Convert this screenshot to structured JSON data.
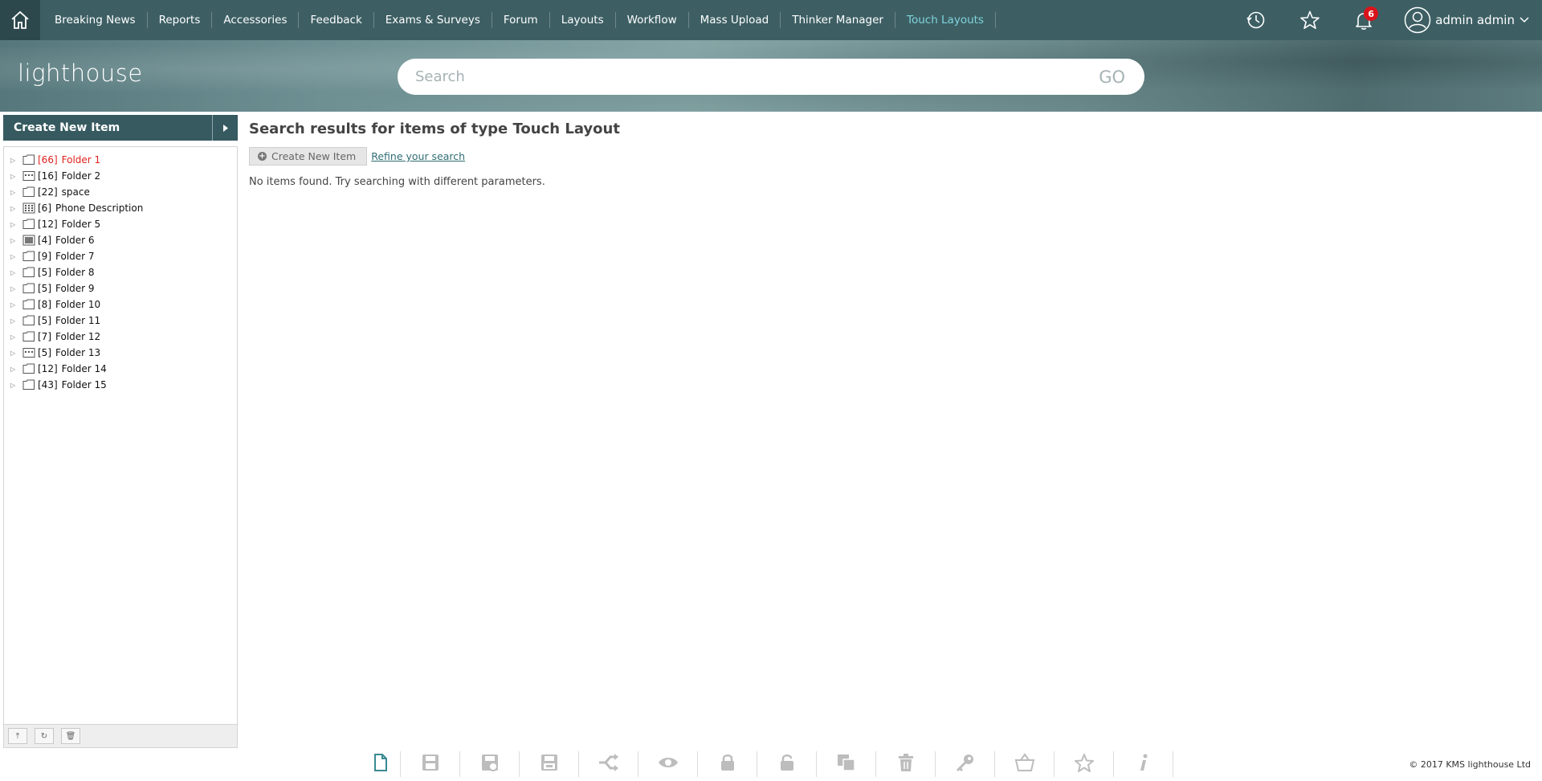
{
  "nav": {
    "items": [
      "Breaking News",
      "Reports",
      "Accessories",
      "Feedback",
      "Exams & Surveys",
      "Forum",
      "Layouts",
      "Workflow",
      "Mass Upload",
      "Thinker Manager",
      "Touch Layouts"
    ],
    "active": "Touch Layouts",
    "notification_count": "6",
    "user_name": "admin admin",
    "icons": [
      "home-icon",
      "history-icon",
      "star-icon",
      "bell-icon",
      "user-icon",
      "chevron-down-icon"
    ]
  },
  "banner": {
    "logo_text": "lighthouse",
    "search_placeholder": "Search",
    "go_label": "GO"
  },
  "sidebar": {
    "create_label": "Create New Item",
    "tree": [
      {
        "count": "[66]",
        "name": "Folder 1",
        "icon": "folder",
        "highlight": true
      },
      {
        "count": "[16]",
        "name": "Folder 2",
        "icon": "dots",
        "highlight": false
      },
      {
        "count": "[22]",
        "name": "space",
        "icon": "folder",
        "highlight": false
      },
      {
        "count": "[6]",
        "name": "Phone Description",
        "icon": "grid",
        "highlight": false
      },
      {
        "count": "[12]",
        "name": "Folder 5",
        "icon": "folder",
        "highlight": false
      },
      {
        "count": "[4]",
        "name": "Folder 6",
        "icon": "filled",
        "highlight": false
      },
      {
        "count": "[9]",
        "name": "Folder 7",
        "icon": "folder",
        "highlight": false
      },
      {
        "count": "[5]",
        "name": "Folder 8",
        "icon": "folder",
        "highlight": false
      },
      {
        "count": "[5]",
        "name": "Folder 9",
        "icon": "folder",
        "highlight": false
      },
      {
        "count": "[8]",
        "name": "Folder 10",
        "icon": "folder",
        "highlight": false
      },
      {
        "count": "[5]",
        "name": "Folder 11",
        "icon": "folder",
        "highlight": false
      },
      {
        "count": "[7]",
        "name": "Folder 12",
        "icon": "folder",
        "highlight": false
      },
      {
        "count": "[5]",
        "name": "Folder 13",
        "icon": "dots",
        "highlight": false
      },
      {
        "count": "[12]",
        "name": "Folder 14",
        "icon": "folder",
        "highlight": false
      },
      {
        "count": "[43]",
        "name": "Folder 15",
        "icon": "folder",
        "highlight": false
      }
    ],
    "footer_icons": [
      "collapse-icon",
      "refresh-icon",
      "trash-icon"
    ]
  },
  "main": {
    "title": "Search results for items of type Touch Layout",
    "create_label": "Create New Item",
    "refine_label": "Refine your search",
    "empty_message": "No items found. Try searching with different parameters."
  },
  "toolbar": {
    "icons": [
      "new-document-icon",
      "save-icon",
      "save-as-icon",
      "save-all-icon",
      "workflow-icon",
      "preview-icon",
      "lock-icon",
      "unlock-icon",
      "copy-icon",
      "delete-icon",
      "permissions-icon",
      "basket-icon",
      "favorite-icon",
      "info-icon"
    ]
  },
  "footer": {
    "copyright": "© 2017 KMS lighthouse Ltd"
  },
  "colors": {
    "nav_bg": "#3d5f64",
    "active_link": "#7fd4dc",
    "badge": "#d9141b",
    "highlight_red": "#e0231c"
  }
}
